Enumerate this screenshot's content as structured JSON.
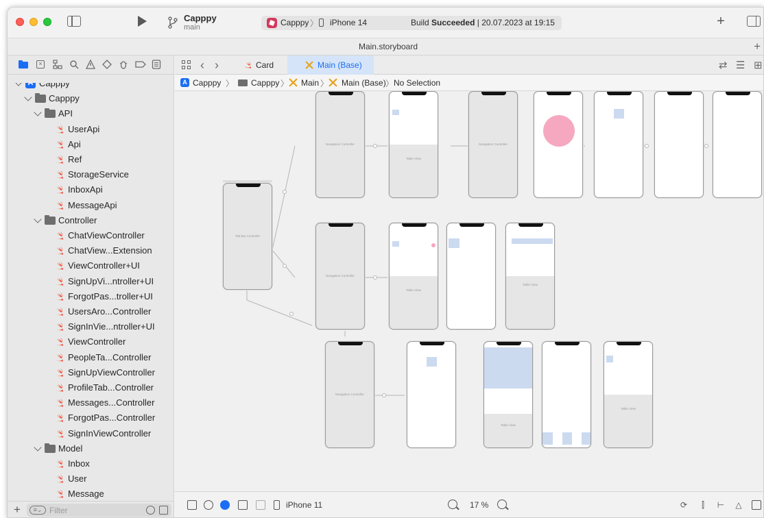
{
  "toolbar": {
    "project_name": "Capppy",
    "branch": "main",
    "scheme_name": "Capppy",
    "scheme_device": "iPhone 14",
    "build_status_prefix": "Build ",
    "build_status_word": "Succeeded",
    "build_status_suffix": " | 20.07.2023 at 19:15",
    "add_icon": "plus-icon"
  },
  "document": {
    "title": "Main.storyboard"
  },
  "navigator": {
    "tabs": [
      "folder-icon",
      "source-control-icon",
      "symbol-icon",
      "find-icon",
      "issue-icon",
      "test-icon",
      "debug-icon",
      "breakpoint-icon",
      "report-icon"
    ],
    "tree": [
      {
        "label": "Capppy",
        "level": 0,
        "kind": "project"
      },
      {
        "label": "Capppy",
        "level": 1,
        "kind": "group"
      },
      {
        "label": "API",
        "level": 2,
        "kind": "group"
      },
      {
        "label": "UserApi",
        "level": 3,
        "kind": "swift"
      },
      {
        "label": "Api",
        "level": 3,
        "kind": "swift"
      },
      {
        "label": "Ref",
        "level": 3,
        "kind": "swift"
      },
      {
        "label": "StorageService",
        "level": 3,
        "kind": "swift"
      },
      {
        "label": "InboxApi",
        "level": 3,
        "kind": "swift"
      },
      {
        "label": "MessageApi",
        "level": 3,
        "kind": "swift"
      },
      {
        "label": "Controller",
        "level": 2,
        "kind": "group"
      },
      {
        "label": "ChatViewController",
        "level": 3,
        "kind": "swift"
      },
      {
        "label": "ChatView...Extension",
        "level": 3,
        "kind": "swift"
      },
      {
        "label": "ViewController+UI",
        "level": 3,
        "kind": "swift"
      },
      {
        "label": "SignUpVi...ntroller+UI",
        "level": 3,
        "kind": "swift"
      },
      {
        "label": "ForgotPas...troller+UI",
        "level": 3,
        "kind": "swift"
      },
      {
        "label": "UsersAro...Controller",
        "level": 3,
        "kind": "swift"
      },
      {
        "label": "SignInVie...ntroller+UI",
        "level": 3,
        "kind": "swift"
      },
      {
        "label": "ViewController",
        "level": 3,
        "kind": "swift"
      },
      {
        "label": "PeopleTa...Controller",
        "level": 3,
        "kind": "swift"
      },
      {
        "label": "SignUpViewController",
        "level": 3,
        "kind": "swift"
      },
      {
        "label": "ProfileTab...Controller",
        "level": 3,
        "kind": "swift"
      },
      {
        "label": "Messages...Controller",
        "level": 3,
        "kind": "swift"
      },
      {
        "label": "ForgotPas...Controller",
        "level": 3,
        "kind": "swift"
      },
      {
        "label": "SignInViewController",
        "level": 3,
        "kind": "swift"
      },
      {
        "label": "Model",
        "level": 2,
        "kind": "group"
      },
      {
        "label": "Inbox",
        "level": 3,
        "kind": "swift"
      },
      {
        "label": "User",
        "level": 3,
        "kind": "swift"
      },
      {
        "label": "Message",
        "level": 3,
        "kind": "swift"
      }
    ],
    "filter_placeholder": "Filter"
  },
  "editor": {
    "tabs": [
      {
        "label": "Card",
        "active": false
      },
      {
        "label": "Main (Base)",
        "active": true
      }
    ],
    "breadcrumb": [
      "Capppy",
      "Capppy",
      "Main",
      "Main (Base)",
      "No Selection"
    ],
    "canvas": {
      "tab_bar_controller_label": "Tab Bar Controller",
      "navigation_controller_label": "Navigation Controller",
      "table_view_label": "Table View",
      "prototype_content_label": "Prototype Content"
    },
    "bottom": {
      "device": "iPhone 11",
      "zoom": "17 %"
    }
  },
  "colors": {
    "accent": "#1b6ef3",
    "swift_orange": "#f05138",
    "active_tab_bg": "#d5e4f8",
    "illustration_pink": "#f6a8c0"
  }
}
